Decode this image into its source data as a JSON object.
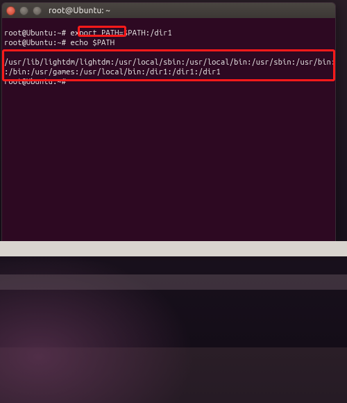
{
  "window": {
    "title": "root@Ubuntu: ~"
  },
  "term": {
    "prompt": "root@Ubuntu:~#",
    "line1_cmd": "export PATH=$PATH:/dir1",
    "line2_cmd": "echo $PATH",
    "blank": "",
    "path_out_1": "/usr/lib/lightdm/lightdm:/usr/local/sbin:/usr/local/bin:/usr/sbin:/usr/bin:/sbin",
    "path_out_2": ":/bin:/usr/games:/usr/local/bin:/dir1:/dir1:/dir1",
    "prompt_end": "root@Ubuntu:~#"
  },
  "colors": {
    "terminal_bg": "#2d0922",
    "highlight": "#ff1a1a"
  }
}
